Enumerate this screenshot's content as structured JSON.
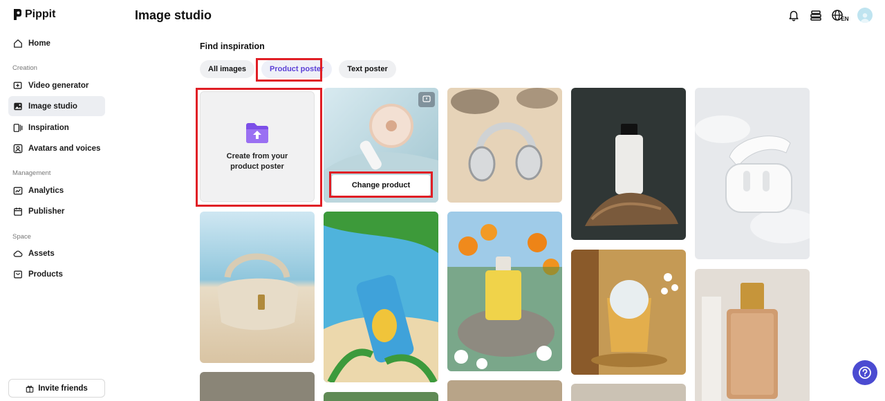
{
  "app": {
    "name": "Pippit"
  },
  "sidebar": {
    "items_top": [
      {
        "label": "Home",
        "icon": "home-icon"
      }
    ],
    "sections": [
      {
        "title": "Creation",
        "items": [
          {
            "label": "Video generator",
            "icon": "video-add-icon"
          },
          {
            "label": "Image studio",
            "icon": "image-icon",
            "active": true
          },
          {
            "label": "Inspiration",
            "icon": "inspiration-icon"
          },
          {
            "label": "Avatars and voices",
            "icon": "avatar-icon"
          }
        ]
      },
      {
        "title": "Management",
        "items": [
          {
            "label": "Analytics",
            "icon": "analytics-icon"
          },
          {
            "label": "Publisher",
            "icon": "calendar-icon"
          }
        ]
      },
      {
        "title": "Space",
        "items": [
          {
            "label": "Assets",
            "icon": "cloud-icon"
          },
          {
            "label": "Products",
            "icon": "bag-icon"
          }
        ]
      }
    ],
    "invite_label": "Invite friends"
  },
  "header": {
    "title": "Image studio",
    "lang": "EN"
  },
  "main": {
    "section_title": "Find inspiration",
    "tabs": [
      {
        "label": "All images"
      },
      {
        "label": "Product poster",
        "active": true
      },
      {
        "label": "Text poster"
      }
    ],
    "upload_card": {
      "line1": "Create from your",
      "line2": "product poster"
    },
    "change_product_label": "Change product",
    "cards": [
      {
        "subject": "handheld fan on sand dune"
      },
      {
        "subject": "headphones on beach sand"
      },
      {
        "subject": "bottle on driftwood"
      },
      {
        "subject": "earbuds case in snow"
      },
      {
        "subject": "beige handbag on beach"
      },
      {
        "subject": "pineapple soda can on beach"
      },
      {
        "subject": "perfume bottle with flowers"
      },
      {
        "subject": "iced whiskey glass"
      },
      {
        "subject": "amber perfume bottle"
      }
    ]
  },
  "colors": {
    "accent": "#5b3fd6",
    "highlight": "#e01e25",
    "help": "#4b4bd1"
  }
}
